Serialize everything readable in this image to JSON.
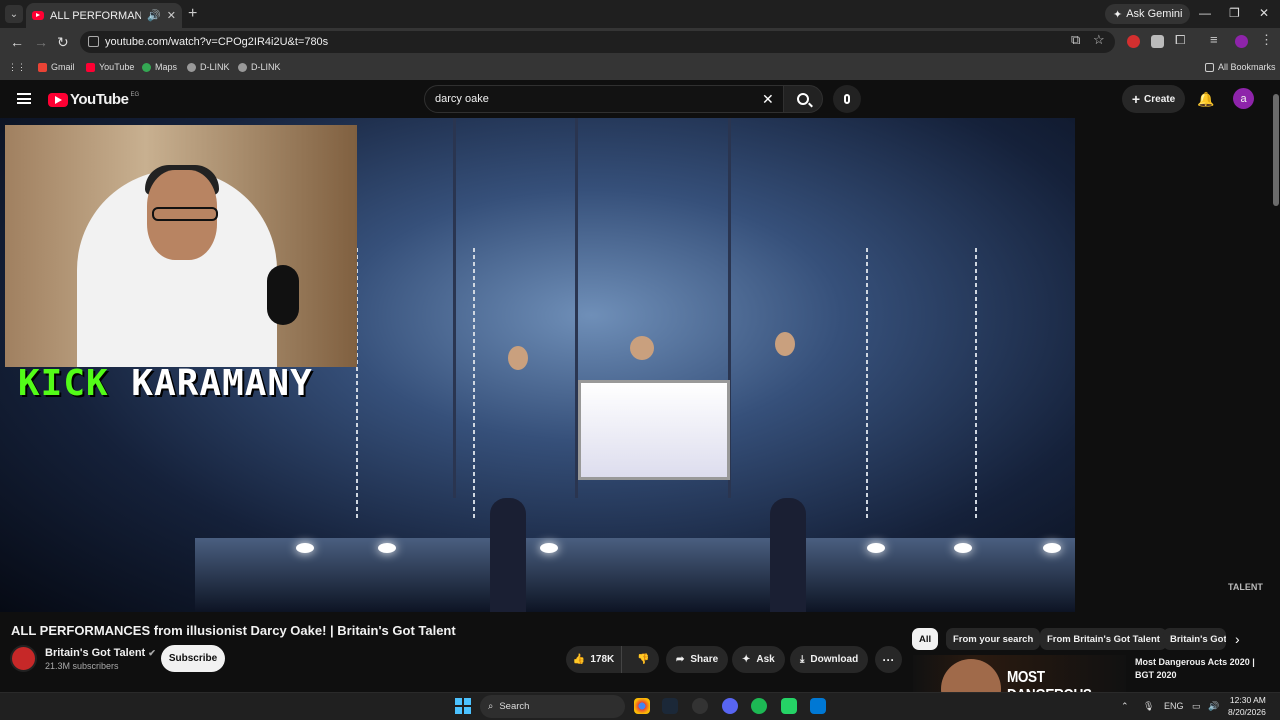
{
  "browser": {
    "tab_title": "ALL PERFORMANCES from",
    "ask_gemini": "Ask Gemini",
    "url": "youtube.com/watch?v=CPOg2IR4i2U&t=780s",
    "bookmarks": [
      "Gmail",
      "YouTube",
      "Maps",
      "D-LINK",
      "D-LINK"
    ],
    "all_bookmarks": "All Bookmarks"
  },
  "header": {
    "logo_text": "YouTube",
    "country_code": "EG",
    "search_query": "darcy oake",
    "create_label": "Create",
    "avatar_letter": "a"
  },
  "player": {
    "overlay_word1": "KICK",
    "overlay_word2": "KARAMANY",
    "watermark": "TALENT"
  },
  "video": {
    "title": "ALL PERFORMANCES from illusionist Darcy Oake! | Britain's Got Talent",
    "channel": "Britain's Got Talent",
    "subscribers": "21.3M subscribers",
    "subscribe_label": "Subscribe",
    "likes": "178K",
    "share_label": "Share",
    "ask_label": "Ask",
    "download_label": "Download"
  },
  "chips": [
    "All",
    "From your search",
    "From Britain's Got Talent",
    "Britain's Got"
  ],
  "recommendation": {
    "thumb_text": "MOST DANGEROUS",
    "title": "Most Dangerous Acts 2020 | BGT 2020"
  },
  "taskbar": {
    "search_label": "Search",
    "lang": "ENG",
    "time": "12:30 AM",
    "date": "8/20/2026"
  },
  "colors": {
    "youtube_red": "#ff0033",
    "kick_green": "#53fc18",
    "avatar_purple": "#8e24aa"
  }
}
